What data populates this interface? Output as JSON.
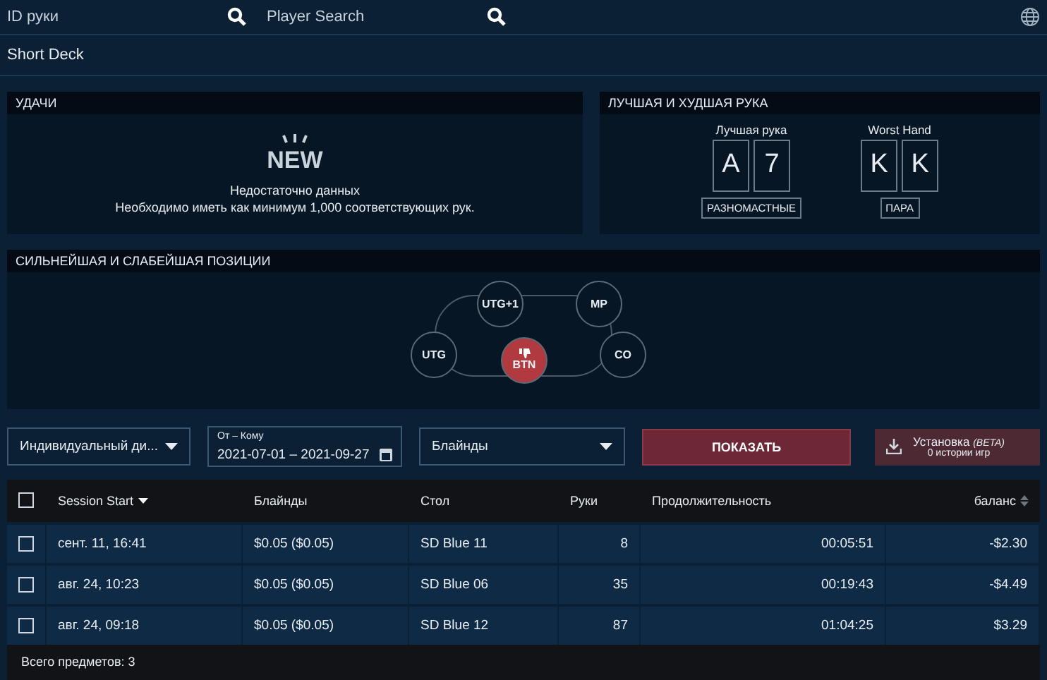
{
  "top_bar": {
    "hand_search": {
      "placeholder": "ID руки"
    },
    "player_search": {
      "placeholder": "Player Search"
    }
  },
  "game_title": "Short Deck",
  "luck_panel": {
    "title": "УДАЧИ",
    "badge": "NEW",
    "message": "Недостаточно данных",
    "detail": "Необходимо иметь как минимум 1,000 соответствующих рук."
  },
  "hands_panel": {
    "title": "ЛУЧШАЯ И ХУДШАЯ РУКА",
    "hands": [
      {
        "label": "Лучшая рука",
        "cards": [
          "A",
          "7"
        ],
        "tag": "РАЗНОМАСТНЫЕ"
      },
      {
        "label": "Worst Hand",
        "cards": [
          "K",
          "K"
        ],
        "tag": "ПАРА"
      }
    ]
  },
  "positions_panel": {
    "title": "СИЛЬНЕЙШАЯ И СЛАБЕЙШАЯ ПОЗИЦИИ",
    "positions": [
      {
        "label": "UTG+1",
        "worst": false
      },
      {
        "label": "MP",
        "worst": false
      },
      {
        "label": "UTG",
        "worst": false
      },
      {
        "label": "BTN",
        "worst": true
      },
      {
        "label": "CO",
        "worst": false
      }
    ]
  },
  "filters": {
    "mode": "Индивидуальный ди...",
    "date_range": {
      "label": "От – Кому",
      "value": "2021-07-01 – 2021-09-27"
    },
    "blinds": {
      "placeholder": "Блайнды"
    },
    "show_button": "ПОКАЗАТЬ",
    "install": {
      "title": "Установка",
      "beta": "(BETA)",
      "subtitle": "0 истории игр"
    }
  },
  "table": {
    "all_checked": false,
    "columns": [
      "Session Start",
      "Блайнды",
      "Стол",
      "Руки",
      "Продолжительность",
      "баланс"
    ],
    "rows": [
      {
        "checked": false,
        "cells": [
          "сент. 11, 16:41",
          "$0.05 ($0.05)",
          "SD Blue 11",
          "8",
          "00:05:51",
          "-$2.30"
        ]
      },
      {
        "checked": false,
        "cells": [
          "авг. 24, 10:23",
          "$0.05 ($0.05)",
          "SD Blue 06",
          "35",
          "00:19:43",
          "-$4.49"
        ]
      },
      {
        "checked": false,
        "cells": [
          "авг. 24, 09:18",
          "$0.05 ($0.05)",
          "SD Blue 12",
          "87",
          "01:04:25",
          "$3.29"
        ]
      }
    ],
    "footer": "Всего предметов: 3"
  }
}
